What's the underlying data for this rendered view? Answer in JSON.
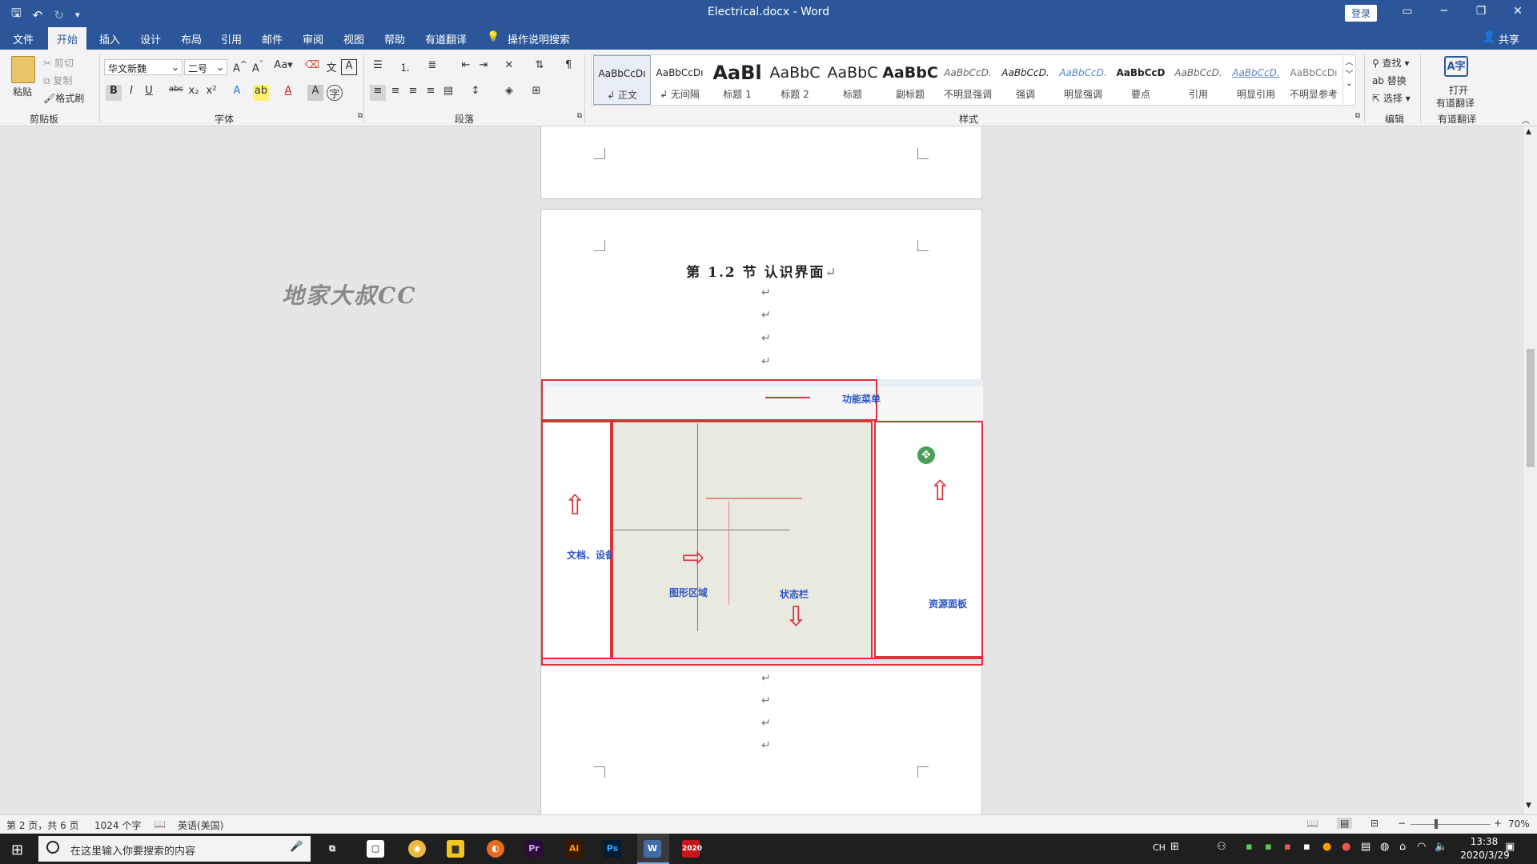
{
  "title_bar": {
    "title": "Electrical.docx  -  Word",
    "login_label": "登录"
  },
  "menu": {
    "items": [
      "文件",
      "开始",
      "插入",
      "设计",
      "布局",
      "引用",
      "邮件",
      "审阅",
      "视图",
      "帮助",
      "有道翻译"
    ],
    "active": "开始",
    "tell_me": "操作说明搜索",
    "share": "共享"
  },
  "ribbon": {
    "clipboard": {
      "paste": "粘贴",
      "cut": "剪切",
      "copy": "复制",
      "format_painter": "格式刷",
      "label": "剪贴板"
    },
    "font": {
      "name": "华文新魏",
      "size": "二号",
      "label": "字体"
    },
    "paragraph": {
      "label": "段落"
    },
    "styles": {
      "label": "样式",
      "items": [
        {
          "sample": "AaBbCcDı",
          "name": "↲ 正文"
        },
        {
          "sample": "AaBbCcDı",
          "name": "↲ 无间隔"
        },
        {
          "sample": "AaBl",
          "name": "标题 1"
        },
        {
          "sample": "AaBbC",
          "name": "标题 2"
        },
        {
          "sample": "AaBbC",
          "name": "标题"
        },
        {
          "sample": "AaBbC",
          "name": "副标题"
        },
        {
          "sample": "AaBbCcD.",
          "name": "不明显强调"
        },
        {
          "sample": "AaBbCcD.",
          "name": "强调"
        },
        {
          "sample": "AaBbCcD.",
          "name": "明显强调"
        },
        {
          "sample": "AaBbCcD",
          "name": "要点"
        },
        {
          "sample": "AaBbCcD.",
          "name": "引用"
        },
        {
          "sample": "AaBbCcD.",
          "name": "明显引用"
        },
        {
          "sample": "AaBbCcDı",
          "name": "不明显参考"
        }
      ]
    },
    "editing": {
      "find": "查找",
      "replace": "替换",
      "select": "选择",
      "label": "编辑"
    },
    "youdao": {
      "open_line1": "打开",
      "open_line2": "有道翻译",
      "label": "有道翻译"
    }
  },
  "document": {
    "watermark": "地家大叔CC",
    "heading": "第 1.2 节  认识界面",
    "para_mark": "↵",
    "screenshot_annotations": {
      "function_menu": "功能菜单",
      "doc_device_manager": "文档、设备管理器",
      "graphics_area": "图形区域",
      "status_bar": "状态栏",
      "resource_panel": "资源面板"
    }
  },
  "status": {
    "page": "第 2 页，共 6 页",
    "words": "1024 个字",
    "language": "英语(美国)",
    "zoom": "70%"
  },
  "taskbar": {
    "search_placeholder": "在这里输入你要搜索的内容",
    "ime": "CH",
    "time": "13:38",
    "date": "2020/3/29",
    "app_badge": "2020"
  },
  "colors": {
    "word_blue": "#2b579a",
    "annotation_red": "#e0303a",
    "annotation_blue": "#2d56c4"
  }
}
